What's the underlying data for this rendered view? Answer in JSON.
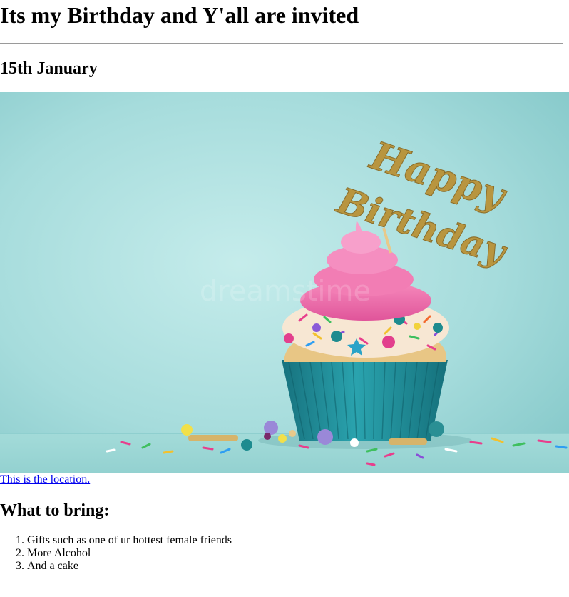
{
  "page": {
    "title": "Its my Birthday and Y'all are invited",
    "date": "15th January",
    "location_link": "This is the location.",
    "bring_heading": "What to bring:",
    "bring_items": [
      "Gifts such as one of ur hottest female friends",
      "More Alcohol",
      "And a cake"
    ]
  },
  "image": {
    "topper_text_line1": "Happy",
    "topper_text_line2": "Birthday",
    "watermark": "dreamstime"
  },
  "colors": {
    "link": "#0000ee",
    "background_teal": "#a9dcdc",
    "frosting_pink": "#f06aa8",
    "wrapper_teal": "#1f8f9c",
    "topper_gold": "#b8953f"
  }
}
